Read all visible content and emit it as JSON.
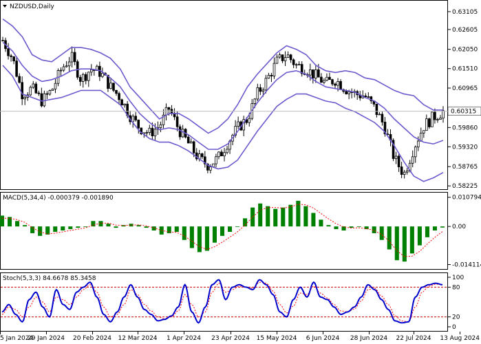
{
  "colors": {
    "background": "#ffffff",
    "text": "#000000",
    "bollinger": "#6a5acd",
    "macd_hist": "#008000",
    "macd_signal": "#ff0000",
    "stoch_main": "#0000cd",
    "stoch_signal": "#ff0000",
    "level_line": "#cc0000"
  },
  "chart_data": [
    {
      "type": "candlestick",
      "title": "NZDUSD,Daily",
      "current_price_label": "0.60315",
      "current_price": 0.60315,
      "ylim": [
        0.58171,
        0.63354
      ],
      "y_ticks": [
        "0.63105",
        "0.62605",
        "0.62050",
        "0.61510",
        "0.60965",
        "0.60315",
        "0.59860",
        "0.59320",
        "0.58765",
        "0.58225"
      ],
      "x_ticks": [
        "5 Jan 2024",
        "29 Jan 2024",
        "20 Feb 2024",
        "12 Mar 2024",
        "1 Apr 2024",
        "23 Apr 2024",
        "15 May 2024",
        "6 Jun 2024",
        "28 Jun 2024",
        "22 Jul 2024",
        "13 Aug 2024"
      ],
      "overlays": [
        "Bollinger Bands"
      ],
      "close_anchors": [
        0.623,
        0.618,
        0.608,
        0.6095,
        0.606,
        0.609,
        0.615,
        0.6185,
        0.612,
        0.615,
        0.614,
        0.61,
        0.607,
        0.602,
        0.5985,
        0.597,
        0.599,
        0.604,
        0.598,
        0.594,
        0.59,
        0.588,
        0.59,
        0.5945,
        0.5985,
        0.601,
        0.608,
        0.612,
        0.617,
        0.619,
        0.616,
        0.615,
        0.613,
        0.611,
        0.612,
        0.6095,
        0.608,
        0.6075,
        0.604,
        0.599,
        0.59,
        0.5855,
        0.593,
        0.599,
        0.6015,
        0.6031
      ],
      "bollinger_upper": [
        0.629,
        0.627,
        0.624,
        0.619,
        0.6175,
        0.617,
        0.619,
        0.621,
        0.621,
        0.6205,
        0.6195,
        0.618,
        0.615,
        0.61,
        0.607,
        0.604,
        0.601,
        0.6025,
        0.6025,
        0.601,
        0.599,
        0.597,
        0.5985,
        0.601,
        0.605,
        0.61,
        0.6135,
        0.6165,
        0.6195,
        0.6215,
        0.6205,
        0.619,
        0.616,
        0.6145,
        0.614,
        0.6145,
        0.614,
        0.6125,
        0.612,
        0.6105,
        0.609,
        0.608,
        0.6075,
        0.605,
        0.6035,
        0.6035
      ],
      "bollinger_middle": [
        0.6225,
        0.62,
        0.616,
        0.613,
        0.6115,
        0.612,
        0.613,
        0.6145,
        0.615,
        0.615,
        0.6145,
        0.6125,
        0.61,
        0.606,
        0.6025,
        0.6,
        0.598,
        0.5985,
        0.598,
        0.5965,
        0.5945,
        0.5925,
        0.5925,
        0.594,
        0.5975,
        0.6015,
        0.6055,
        0.609,
        0.612,
        0.614,
        0.6145,
        0.6135,
        0.6115,
        0.61,
        0.6095,
        0.609,
        0.6085,
        0.607,
        0.606,
        0.604,
        0.601,
        0.5985,
        0.596,
        0.5945,
        0.594,
        0.595
      ],
      "bollinger_lower": [
        0.616,
        0.613,
        0.608,
        0.607,
        0.606,
        0.6065,
        0.607,
        0.608,
        0.609,
        0.609,
        0.609,
        0.607,
        0.605,
        0.601,
        0.5975,
        0.5955,
        0.5945,
        0.5945,
        0.5935,
        0.592,
        0.59,
        0.588,
        0.587,
        0.5875,
        0.5895,
        0.5935,
        0.5975,
        0.601,
        0.6045,
        0.6065,
        0.608,
        0.608,
        0.607,
        0.606,
        0.6055,
        0.604,
        0.603,
        0.6015,
        0.6,
        0.5975,
        0.5935,
        0.589,
        0.585,
        0.5835,
        0.5845,
        0.586
      ]
    },
    {
      "type": "bar",
      "title": "MACD(5,34,4) -0.000379 -0.001890",
      "ylim": [
        -0.0155,
        0.012
      ],
      "y_ticks": [
        "0.010794",
        "0.00",
        "-0.014114"
      ],
      "series": [
        {
          "values": [
            0.004,
            0.0035,
            0.002,
            0.0005,
            -0.0025,
            -0.0035,
            -0.003,
            -0.002,
            -0.0015,
            -0.001,
            -0.0005,
            0.0,
            0.002,
            0.002,
            0.001,
            -0.0005,
            0.0005,
            0.001,
            0.0005,
            -0.0005,
            -0.0015,
            -0.003,
            -0.0025,
            -0.002,
            -0.005,
            -0.008,
            -0.0095,
            -0.009,
            -0.006,
            -0.0035,
            -0.002,
            0.0,
            0.003,
            0.007,
            0.0085,
            0.0075,
            0.0065,
            0.007,
            0.008,
            0.0095,
            0.0075,
            0.005,
            0.0025,
            0.0005,
            -0.001,
            -0.0015,
            -0.0005,
            0.0,
            -0.001,
            -0.0025,
            -0.005,
            -0.0085,
            -0.0125,
            -0.013,
            -0.01,
            -0.007,
            -0.004,
            -0.0015,
            -0.0004
          ]
        },
        {
          "values": [
            0.003,
            0.003,
            0.0025,
            0.0015,
            -0.0005,
            -0.002,
            -0.0028,
            -0.0025,
            -0.002,
            -0.0015,
            -0.001,
            -0.0005,
            0.0005,
            0.0012,
            0.0012,
            0.0005,
            0.0003,
            0.0005,
            0.0006,
            0.0002,
            -0.0005,
            -0.0015,
            -0.002,
            -0.0022,
            -0.0035,
            -0.0055,
            -0.0075,
            -0.0085,
            -0.0075,
            -0.0058,
            -0.004,
            -0.002,
            0.0005,
            0.0035,
            0.006,
            0.007,
            0.007,
            0.0068,
            0.0072,
            0.0082,
            0.008,
            0.0068,
            0.0048,
            0.0028,
            0.001,
            -0.0002,
            -0.0006,
            -0.0005,
            -0.0008,
            -0.0015,
            -0.003,
            -0.0055,
            -0.009,
            -0.0112,
            -0.011,
            -0.0092,
            -0.0065,
            -0.004,
            -0.0019
          ]
        }
      ]
    },
    {
      "type": "line",
      "title": "Stoch(5,3,3) 84.6678 85.3458",
      "ylim": [
        0,
        100
      ],
      "y_ticks": [
        "100",
        "80",
        "20",
        "0"
      ],
      "levels": [
        80,
        20
      ],
      "series": [
        {
          "values": [
            30,
            45,
            25,
            10,
            55,
            70,
            40,
            20,
            75,
            45,
            35,
            70,
            80,
            90,
            60,
            25,
            10,
            30,
            60,
            85,
            60,
            35,
            25,
            12,
            15,
            22,
            40,
            85,
            30,
            8,
            40,
            85,
            95,
            55,
            80,
            85,
            80,
            75,
            95,
            85,
            65,
            30,
            20,
            55,
            80,
            60,
            90,
            60,
            55,
            40,
            25,
            30,
            40,
            60,
            85,
            75,
            55,
            35,
            12,
            8,
            10,
            60,
            80,
            85,
            88,
            85
          ]
        },
        {
          "values": [
            25,
            40,
            35,
            20,
            40,
            60,
            50,
            30,
            60,
            55,
            45,
            60,
            75,
            85,
            70,
            40,
            20,
            25,
            45,
            75,
            65,
            45,
            32,
            20,
            16,
            20,
            32,
            65,
            45,
            20,
            30,
            70,
            88,
            70,
            75,
            82,
            80,
            78,
            90,
            88,
            72,
            45,
            28,
            42,
            68,
            65,
            82,
            68,
            58,
            45,
            32,
            30,
            36,
            52,
            75,
            78,
            62,
            45,
            22,
            12,
            10,
            40,
            70,
            82,
            86,
            85
          ]
        }
      ]
    }
  ]
}
